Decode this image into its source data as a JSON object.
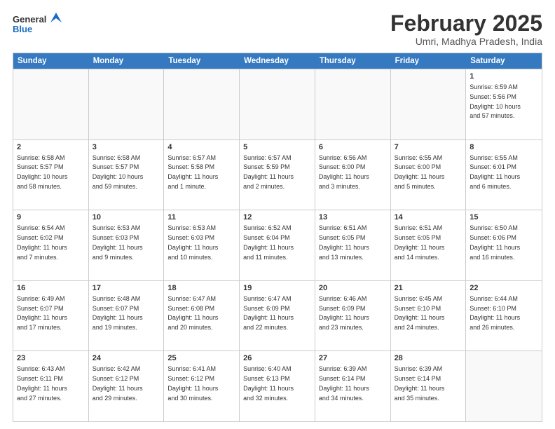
{
  "logo": {
    "line1": "General",
    "line2": "Blue"
  },
  "title": "February 2025",
  "location": "Umri, Madhya Pradesh, India",
  "days_of_week": [
    "Sunday",
    "Monday",
    "Tuesday",
    "Wednesday",
    "Thursday",
    "Friday",
    "Saturday"
  ],
  "weeks": [
    [
      {
        "day": "",
        "info": ""
      },
      {
        "day": "",
        "info": ""
      },
      {
        "day": "",
        "info": ""
      },
      {
        "day": "",
        "info": ""
      },
      {
        "day": "",
        "info": ""
      },
      {
        "day": "",
        "info": ""
      },
      {
        "day": "1",
        "info": "Sunrise: 6:59 AM\nSunset: 5:56 PM\nDaylight: 10 hours\nand 57 minutes."
      }
    ],
    [
      {
        "day": "2",
        "info": "Sunrise: 6:58 AM\nSunset: 5:57 PM\nDaylight: 10 hours\nand 58 minutes."
      },
      {
        "day": "3",
        "info": "Sunrise: 6:58 AM\nSunset: 5:57 PM\nDaylight: 10 hours\nand 59 minutes."
      },
      {
        "day": "4",
        "info": "Sunrise: 6:57 AM\nSunset: 5:58 PM\nDaylight: 11 hours\nand 1 minute."
      },
      {
        "day": "5",
        "info": "Sunrise: 6:57 AM\nSunset: 5:59 PM\nDaylight: 11 hours\nand 2 minutes."
      },
      {
        "day": "6",
        "info": "Sunrise: 6:56 AM\nSunset: 6:00 PM\nDaylight: 11 hours\nand 3 minutes."
      },
      {
        "day": "7",
        "info": "Sunrise: 6:55 AM\nSunset: 6:00 PM\nDaylight: 11 hours\nand 5 minutes."
      },
      {
        "day": "8",
        "info": "Sunrise: 6:55 AM\nSunset: 6:01 PM\nDaylight: 11 hours\nand 6 minutes."
      }
    ],
    [
      {
        "day": "9",
        "info": "Sunrise: 6:54 AM\nSunset: 6:02 PM\nDaylight: 11 hours\nand 7 minutes."
      },
      {
        "day": "10",
        "info": "Sunrise: 6:53 AM\nSunset: 6:03 PM\nDaylight: 11 hours\nand 9 minutes."
      },
      {
        "day": "11",
        "info": "Sunrise: 6:53 AM\nSunset: 6:03 PM\nDaylight: 11 hours\nand 10 minutes."
      },
      {
        "day": "12",
        "info": "Sunrise: 6:52 AM\nSunset: 6:04 PM\nDaylight: 11 hours\nand 11 minutes."
      },
      {
        "day": "13",
        "info": "Sunrise: 6:51 AM\nSunset: 6:05 PM\nDaylight: 11 hours\nand 13 minutes."
      },
      {
        "day": "14",
        "info": "Sunrise: 6:51 AM\nSunset: 6:05 PM\nDaylight: 11 hours\nand 14 minutes."
      },
      {
        "day": "15",
        "info": "Sunrise: 6:50 AM\nSunset: 6:06 PM\nDaylight: 11 hours\nand 16 minutes."
      }
    ],
    [
      {
        "day": "16",
        "info": "Sunrise: 6:49 AM\nSunset: 6:07 PM\nDaylight: 11 hours\nand 17 minutes."
      },
      {
        "day": "17",
        "info": "Sunrise: 6:48 AM\nSunset: 6:07 PM\nDaylight: 11 hours\nand 19 minutes."
      },
      {
        "day": "18",
        "info": "Sunrise: 6:47 AM\nSunset: 6:08 PM\nDaylight: 11 hours\nand 20 minutes."
      },
      {
        "day": "19",
        "info": "Sunrise: 6:47 AM\nSunset: 6:09 PM\nDaylight: 11 hours\nand 22 minutes."
      },
      {
        "day": "20",
        "info": "Sunrise: 6:46 AM\nSunset: 6:09 PM\nDaylight: 11 hours\nand 23 minutes."
      },
      {
        "day": "21",
        "info": "Sunrise: 6:45 AM\nSunset: 6:10 PM\nDaylight: 11 hours\nand 24 minutes."
      },
      {
        "day": "22",
        "info": "Sunrise: 6:44 AM\nSunset: 6:10 PM\nDaylight: 11 hours\nand 26 minutes."
      }
    ],
    [
      {
        "day": "23",
        "info": "Sunrise: 6:43 AM\nSunset: 6:11 PM\nDaylight: 11 hours\nand 27 minutes."
      },
      {
        "day": "24",
        "info": "Sunrise: 6:42 AM\nSunset: 6:12 PM\nDaylight: 11 hours\nand 29 minutes."
      },
      {
        "day": "25",
        "info": "Sunrise: 6:41 AM\nSunset: 6:12 PM\nDaylight: 11 hours\nand 30 minutes."
      },
      {
        "day": "26",
        "info": "Sunrise: 6:40 AM\nSunset: 6:13 PM\nDaylight: 11 hours\nand 32 minutes."
      },
      {
        "day": "27",
        "info": "Sunrise: 6:39 AM\nSunset: 6:14 PM\nDaylight: 11 hours\nand 34 minutes."
      },
      {
        "day": "28",
        "info": "Sunrise: 6:39 AM\nSunset: 6:14 PM\nDaylight: 11 hours\nand 35 minutes."
      },
      {
        "day": "",
        "info": ""
      }
    ]
  ]
}
